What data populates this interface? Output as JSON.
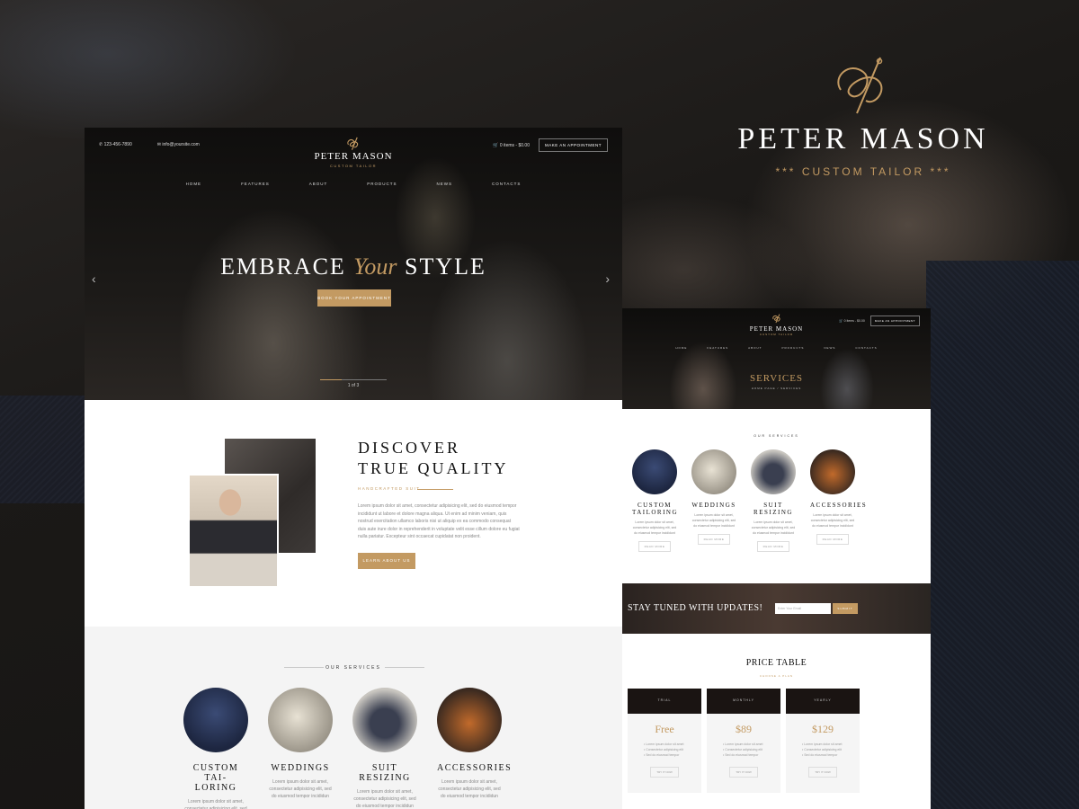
{
  "brand": {
    "name": "PETER MASON",
    "tagline": "CUSTOM TAILOR",
    "tagline_decorated": "*** CUSTOM TAILOR ***"
  },
  "colors": {
    "accent": "#c39a62",
    "dark": "#161412",
    "light_section": "#f4f4f4"
  },
  "left_page": {
    "topbar": {
      "phone": "123-456-7890",
      "email": "info@yoursite.com",
      "cart": "0 items - $0.00",
      "appointment_button": "MAKE AN APPOINTMENT"
    },
    "nav": [
      "HOME",
      "FEATURES",
      "ABOUT",
      "PRODUCTS",
      "NEWS",
      "CONTACTS"
    ],
    "hero": {
      "headline_left": "EMBRACE",
      "headline_accent": "Your",
      "headline_right": "STYLE",
      "cta": "BOOK YOUR APPOINTMENT",
      "slide_counter": "1 of 3",
      "slide_progress": 0.33
    },
    "discover": {
      "title_line1": "DISCOVER",
      "title_line2": "TRUE QUALITY",
      "eyebrow": "HANDCRAFTED SUIT",
      "body": "Lorem ipsum dolor sit amet, consectetur adipisicing elit, sed do eiusmod tempor incididunt ut labore et dolore magna aliqua. Ut enim ad minim veniam, quis nostrud exercitation ullamco laboris nisi ut aliquip ex ea commodo consequat duis aute irure dolor in reprehenderit in voluptate velit esse cillum dolore eu fugiat nulla pariatur. Excepteur sint occaecat cupidatat non proident.",
      "cta": "LEARN ABOUT US"
    },
    "services": {
      "section_title": "OUR SERVICES",
      "items": [
        {
          "title_line1": "CUSTOM TAI-",
          "title_line2": "LORING",
          "text": "Lorem ipsum dolor sit amet, consectetur adipisicing elit, sed do eiusmod tempor incididun"
        },
        {
          "title_line1": "WEDDINGS",
          "title_line2": "",
          "text": "Lorem ipsum dolor sit amet, consectetur adipisicing elit, sed do eiusmod tempor incididun"
        },
        {
          "title_line1": "SUIT",
          "title_line2": "RESIZING",
          "text": "Lorem ipsum dolor sit amet, consectetur adipisicing elit, sed do eiusmod tempor incididun"
        },
        {
          "title_line1": "ACCESSORIES",
          "title_line2": "",
          "text": "Lorem ipsum dolor sit amet, consectetur adipisicing elit, sed do eiusmod tempor incididun"
        }
      ]
    }
  },
  "right_page": {
    "topbar": {
      "cart": "0 items - $0.00",
      "appointment_button": "MAKE AN APPOINTMENT"
    },
    "nav": [
      "HOME",
      "FEATURES",
      "ABOUT",
      "PRODUCTS",
      "NEWS",
      "CONTACTS"
    ],
    "page_title": "SERVICES",
    "breadcrumb": "HOME PAGE / SERVICES",
    "services": {
      "section_title": "OUR SERVICES",
      "more_label": "READ MORE",
      "items": [
        {
          "title_line1": "CUSTOM",
          "title_line2": "TAILORING",
          "text": "Lorem ipsum dolor sit amet, consectetur adipisicing elit, sed do eiusmod tempor incididunt"
        },
        {
          "title_line1": "WEDDINGS",
          "title_line2": "",
          "text": "Lorem ipsum dolor sit amet, consectetur adipisicing elit, sed do eiusmod tempor incididunt"
        },
        {
          "title_line1": "SUIT",
          "title_line2": "RESIZING",
          "text": "Lorem ipsum dolor sit amet, consectetur adipisicing elit, sed do eiusmod tempor incididunt"
        },
        {
          "title_line1": "ACCESSORIES",
          "title_line2": "",
          "text": "Lorem ipsum dolor sit amet, consectetur adipisicing elit, sed do eiusmod tempor incididunt"
        }
      ]
    },
    "newsletter": {
      "title": "STAY TUNED WITH UPDATES!",
      "email_placeholder": "Enter Your Email",
      "submit": "SUBMIT"
    },
    "pricing": {
      "title": "PRICE TABLE",
      "eyebrow": "CHOOSE A PLAN",
      "try_label": "TRY IT NOW",
      "plans": [
        {
          "name": "TRIAL",
          "price": "Free",
          "features": [
            "Lorem ipsum dolor sit amet",
            "Consectetur adipisicing elit",
            "Sed do eiusmod tempor"
          ]
        },
        {
          "name": "MONTHLY",
          "price": "$89",
          "features": [
            "Lorem ipsum dolor sit amet",
            "Consectetur adipisicing elit",
            "Sed do eiusmod tempor"
          ]
        },
        {
          "name": "YEARLY",
          "price": "$129",
          "features": [
            "Lorem ipsum dolor sit amet",
            "Consectetur adipisicing elit",
            "Sed do eiusmod tempor"
          ]
        }
      ]
    }
  }
}
